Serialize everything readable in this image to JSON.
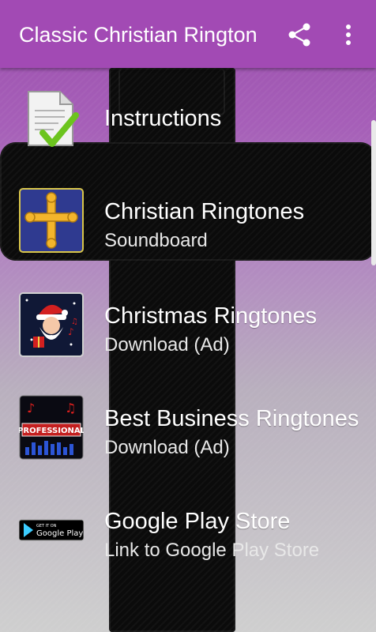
{
  "app_bar": {
    "title": "Classic Christian Ringtones",
    "share_icon": "share-icon",
    "more_icon": "more-vertical-icon",
    "color": "#a24ab4"
  },
  "menu": {
    "items": [
      {
        "title": "Instructions",
        "subtitle": "",
        "icon": "document-check-icon"
      },
      {
        "title": "Christian Ringtones",
        "subtitle": "Soundboard",
        "icon": "cross-icon"
      },
      {
        "title": "Christmas Ringtones",
        "subtitle": "Download (Ad)",
        "icon": "santa-icon"
      },
      {
        "title": "Best Business Ringtones",
        "subtitle": "Download (Ad)",
        "icon": "professional-icon"
      },
      {
        "title": "Google Play Store",
        "subtitle": "Link to Google Play Store",
        "icon": "google-play-badge-icon"
      }
    ]
  },
  "badges": {
    "professional": "PROFESSIONAL",
    "get_it_on": "GET IT ON",
    "google_play": "Google Play"
  }
}
